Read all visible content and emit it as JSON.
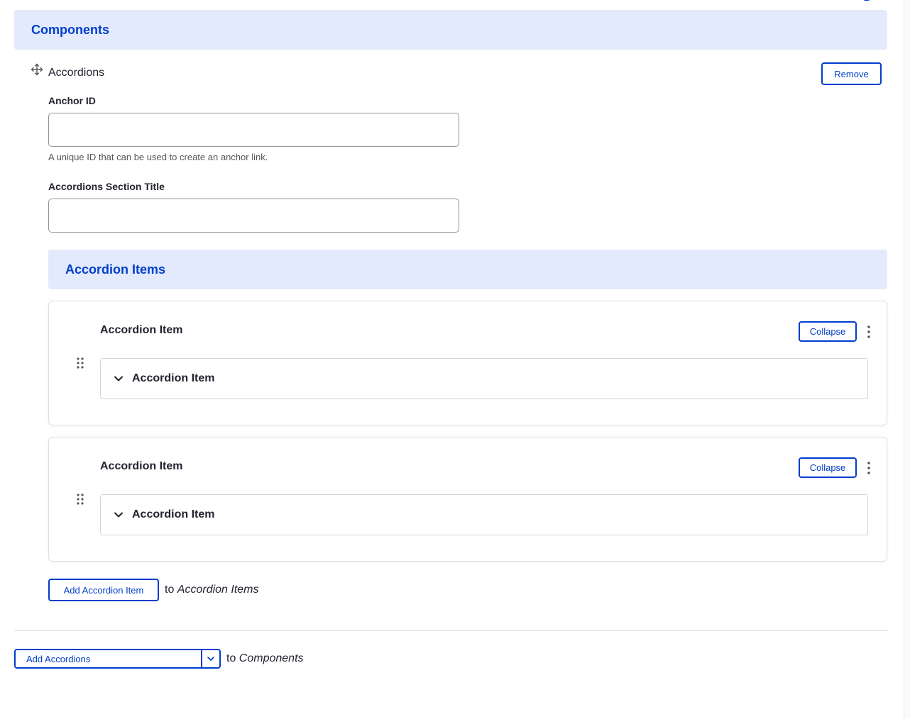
{
  "components": {
    "header_title": "Components",
    "component_label": "Accordions",
    "remove_label": "Remove"
  },
  "fields": {
    "anchor": {
      "label": "Anchor ID",
      "value": "",
      "description": "A unique ID that can be used to create an anchor link."
    },
    "section_title": {
      "label": "Accordions Section Title",
      "value": ""
    }
  },
  "accordion_items": {
    "header_title": "Accordion Items",
    "items": [
      {
        "title": "Accordion Item",
        "collapse_label": "Collapse",
        "details_title": "Accordion Item"
      },
      {
        "title": "Accordion Item",
        "collapse_label": "Collapse",
        "details_title": "Accordion Item"
      }
    ],
    "add_button_label": "Add Accordion Item",
    "to_prefix": "to",
    "to_target": "Accordion Items"
  },
  "footer": {
    "add_button_label": "Add Accordions",
    "to_prefix": "to",
    "to_target": "Components"
  },
  "icons": {
    "move": "move-arrows-icon",
    "drag": "drag-handle-icon",
    "kebab": "kebab-menu-icon",
    "chevron": "chevron-down-icon"
  },
  "colors": {
    "accent": "#003ecc",
    "header_bg": "#e3eafc",
    "text": "#222330"
  }
}
